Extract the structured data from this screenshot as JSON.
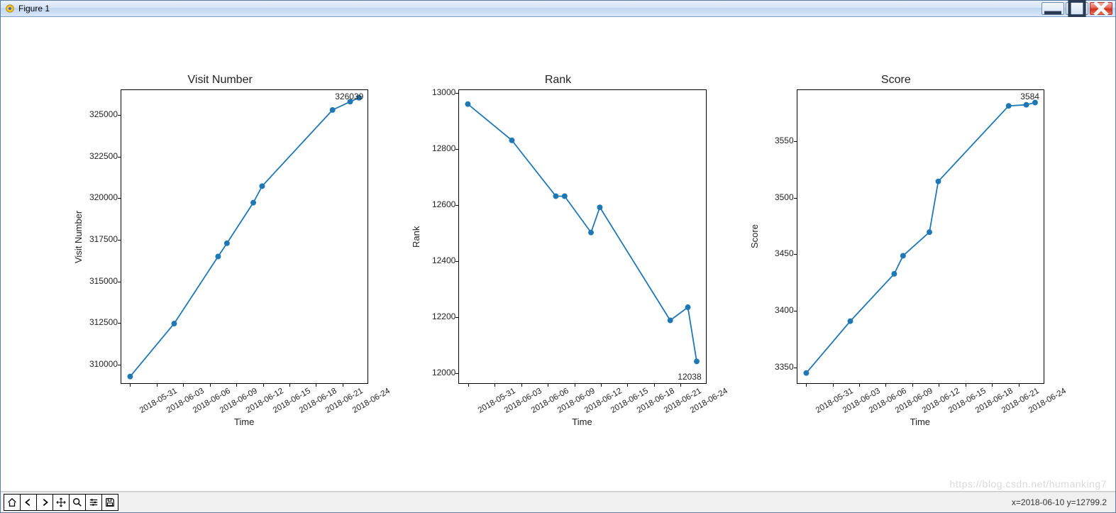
{
  "window": {
    "title": "Figure 1"
  },
  "chart_data": [
    {
      "type": "line",
      "title": "Visit Number",
      "xlabel": "Time",
      "ylabel": "Visit Number",
      "xticks": [
        "2018-05-31",
        "2018-06-03",
        "2018-06-06",
        "2018-06-09",
        "2018-06-12",
        "2018-06-15",
        "2018-06-18",
        "2018-06-21",
        "2018-06-24"
      ],
      "yticks": [
        310000,
        312500,
        315000,
        317500,
        320000,
        322500,
        325000
      ],
      "ylim": [
        308800,
        326500
      ],
      "annotation": "326039",
      "annotation_pos": "top-right",
      "x": [
        "2018-05-31",
        "2018-06-05",
        "2018-06-10",
        "2018-06-11",
        "2018-06-14",
        "2018-06-15",
        "2018-06-23",
        "2018-06-25",
        "2018-06-26"
      ],
      "y": [
        309200,
        312400,
        316450,
        317250,
        319700,
        320700,
        325300,
        325800,
        326039
      ]
    },
    {
      "type": "line",
      "title": "Rank",
      "xlabel": "Time",
      "ylabel": "Rank",
      "xticks": [
        "2018-05-31",
        "2018-06-03",
        "2018-06-06",
        "2018-06-09",
        "2018-06-12",
        "2018-06-15",
        "2018-06-18",
        "2018-06-21",
        "2018-06-24"
      ],
      "yticks": [
        12000,
        12200,
        12400,
        12600,
        12800,
        13000
      ],
      "ylim": [
        11960,
        13010
      ],
      "annotation": "12038",
      "annotation_pos": "bottom-right",
      "x": [
        "2018-05-31",
        "2018-06-05",
        "2018-06-10",
        "2018-06-11",
        "2018-06-14",
        "2018-06-15",
        "2018-06-23",
        "2018-06-25",
        "2018-06-26"
      ],
      "y": [
        12960,
        12830,
        12630,
        12630,
        12500,
        12590,
        12185,
        12232,
        12038
      ]
    },
    {
      "type": "line",
      "title": "Score",
      "xlabel": "Time",
      "ylabel": "Score",
      "xticks": [
        "2018-05-31",
        "2018-06-03",
        "2018-06-06",
        "2018-06-09",
        "2018-06-12",
        "2018-06-15",
        "2018-06-18",
        "2018-06-21",
        "2018-06-24"
      ],
      "yticks": [
        3350,
        3400,
        3450,
        3500,
        3550
      ],
      "ylim": [
        3335,
        3595
      ],
      "annotation": "3584",
      "annotation_pos": "top-right",
      "x": [
        "2018-05-31",
        "2018-06-05",
        "2018-06-10",
        "2018-06-11",
        "2018-06-14",
        "2018-06-15",
        "2018-06-23",
        "2018-06-25",
        "2018-06-26"
      ],
      "y": [
        3344,
        3390,
        3432,
        3448,
        3469,
        3514,
        3581,
        3582,
        3584
      ]
    }
  ],
  "date_axis": {
    "start": "2018-05-30",
    "end": "2018-06-27"
  },
  "status": {
    "coords": "x=2018-06-10 y=12799.2"
  },
  "watermark": "https://blog.csdn.net/humanking7",
  "toolbar": {
    "home": "Home",
    "back": "Back",
    "forward": "Forward",
    "pan": "Pan",
    "zoom": "Zoom",
    "config": "Configure",
    "save": "Save"
  }
}
